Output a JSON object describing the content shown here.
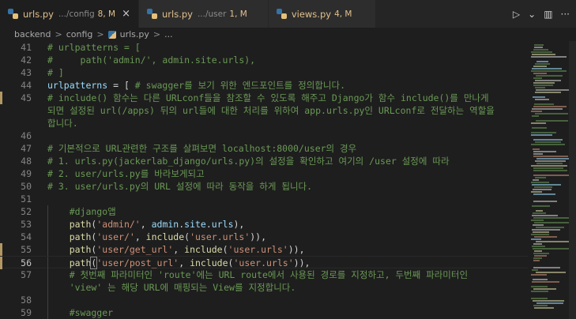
{
  "tabs": [
    {
      "name": "urls.py",
      "desc": ".../config",
      "badge": "8, M",
      "close": "×",
      "active": true
    },
    {
      "name": "urls.py",
      "desc": ".../user",
      "badge": "1, M",
      "active": false
    },
    {
      "name": "views.py",
      "desc": "",
      "badge": "4, M",
      "active": false
    }
  ],
  "actions": {
    "run": "▷",
    "dropdown": "⌄",
    "split": "▥",
    "more": "···"
  },
  "breadcrumb": {
    "folder1": "backend",
    "folder2": "config",
    "file": "urls.py",
    "tail": "...",
    "sep": ">"
  },
  "lines": [
    {
      "n": "41",
      "t": "# urlpatterns = ["
    },
    {
      "n": "42",
      "t": "#     path('admin/', admin.site.urls),"
    },
    {
      "n": "43",
      "t": "# ]"
    },
    {
      "n": "44",
      "a": "urlpatterns",
      "b": " = [ ",
      "c": "# swagger를 보기 위한 엔드포인트를 정의합니다."
    },
    {
      "n": "45",
      "t": "# include() 함수는 다른 URLconf들을 참조할 수 있도록 해주고 Django가 함수 include()를 만나게"
    },
    {
      "n": "",
      "t": "되면 설정된 url(/apps) 뒤의 url들에 대한 처리를 위하여 app.urls.py인 URLconf로 전달하는 역할을"
    },
    {
      "n": "",
      "t": "합니다."
    },
    {
      "n": "46",
      "t": ""
    },
    {
      "n": "47",
      "t": "# 기본적으로 URL관련한 구조를 살펴보면 localhost:8000/user의 경우"
    },
    {
      "n": "48",
      "t": "# 1. urls.py(jackerlab_django/urls.py)의 설정을 확인하고 여기의 /user 설정에 따라"
    },
    {
      "n": "49",
      "t": "# 2. user/urls.py를 바라보게되고"
    },
    {
      "n": "50",
      "t": "# 3. user/urls.py의 URL 설정에 따라 동작을 하게 됩니다."
    },
    {
      "n": "51",
      "t": ""
    },
    {
      "n": "52",
      "t": "    #django앱"
    },
    {
      "n": "53",
      "fn": "path",
      "s1": "'admin/'",
      "mid": ", ",
      "v1": "admin",
      "dot1": ".",
      "v2": "site",
      "dot2": ".",
      "v3": "urls",
      "end": "),"
    },
    {
      "n": "54",
      "fn": "path",
      "s1": "'user/'",
      "mid": ", ",
      "fn2": "include",
      "s2": "'user.urls'",
      "end": ")),"
    },
    {
      "n": "55",
      "fn": "path",
      "s1": "'user/get_url'",
      "mid": ", ",
      "fn2": "include",
      "s2": "'user.urls'",
      "end": ")),"
    },
    {
      "n": "56",
      "fn": "path",
      "s1": "'user/post_url'",
      "mid": ", ",
      "fn2": "include",
      "s2": "'user.urls'",
      "end": ")),"
    },
    {
      "n": "57",
      "t": "    # 첫번째 파라미터인 'route'에는 URL route에서 사용된 경로를 지정하고, 두번째 파라미터인"
    },
    {
      "n": "",
      "t": "    'view' 는 해당 URL에 매핑되는 View를 지정합니다."
    },
    {
      "n": "58",
      "t": ""
    },
    {
      "n": "59",
      "t": "    #swagger"
    }
  ],
  "colors": {
    "comment": "#6a9955",
    "variable": "#9cdcfe",
    "function": "#dcdcaa",
    "string": "#ce9178",
    "modified": "#e2c08d"
  }
}
